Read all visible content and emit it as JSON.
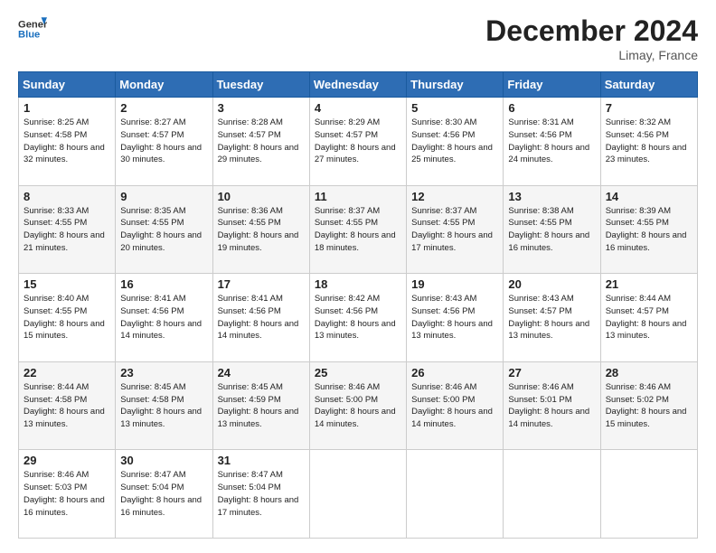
{
  "header": {
    "logo_general": "General",
    "logo_blue": "Blue",
    "month_title": "December 2024",
    "location": "Limay, France"
  },
  "days_of_week": [
    "Sunday",
    "Monday",
    "Tuesday",
    "Wednesday",
    "Thursday",
    "Friday",
    "Saturday"
  ],
  "weeks": [
    [
      {
        "day": "1",
        "sunrise": "Sunrise: 8:25 AM",
        "sunset": "Sunset: 4:58 PM",
        "daylight": "Daylight: 8 hours and 32 minutes."
      },
      {
        "day": "2",
        "sunrise": "Sunrise: 8:27 AM",
        "sunset": "Sunset: 4:57 PM",
        "daylight": "Daylight: 8 hours and 30 minutes."
      },
      {
        "day": "3",
        "sunrise": "Sunrise: 8:28 AM",
        "sunset": "Sunset: 4:57 PM",
        "daylight": "Daylight: 8 hours and 29 minutes."
      },
      {
        "day": "4",
        "sunrise": "Sunrise: 8:29 AM",
        "sunset": "Sunset: 4:57 PM",
        "daylight": "Daylight: 8 hours and 27 minutes."
      },
      {
        "day": "5",
        "sunrise": "Sunrise: 8:30 AM",
        "sunset": "Sunset: 4:56 PM",
        "daylight": "Daylight: 8 hours and 25 minutes."
      },
      {
        "day": "6",
        "sunrise": "Sunrise: 8:31 AM",
        "sunset": "Sunset: 4:56 PM",
        "daylight": "Daylight: 8 hours and 24 minutes."
      },
      {
        "day": "7",
        "sunrise": "Sunrise: 8:32 AM",
        "sunset": "Sunset: 4:56 PM",
        "daylight": "Daylight: 8 hours and 23 minutes."
      }
    ],
    [
      {
        "day": "8",
        "sunrise": "Sunrise: 8:33 AM",
        "sunset": "Sunset: 4:55 PM",
        "daylight": "Daylight: 8 hours and 21 minutes."
      },
      {
        "day": "9",
        "sunrise": "Sunrise: 8:35 AM",
        "sunset": "Sunset: 4:55 PM",
        "daylight": "Daylight: 8 hours and 20 minutes."
      },
      {
        "day": "10",
        "sunrise": "Sunrise: 8:36 AM",
        "sunset": "Sunset: 4:55 PM",
        "daylight": "Daylight: 8 hours and 19 minutes."
      },
      {
        "day": "11",
        "sunrise": "Sunrise: 8:37 AM",
        "sunset": "Sunset: 4:55 PM",
        "daylight": "Daylight: 8 hours and 18 minutes."
      },
      {
        "day": "12",
        "sunrise": "Sunrise: 8:37 AM",
        "sunset": "Sunset: 4:55 PM",
        "daylight": "Daylight: 8 hours and 17 minutes."
      },
      {
        "day": "13",
        "sunrise": "Sunrise: 8:38 AM",
        "sunset": "Sunset: 4:55 PM",
        "daylight": "Daylight: 8 hours and 16 minutes."
      },
      {
        "day": "14",
        "sunrise": "Sunrise: 8:39 AM",
        "sunset": "Sunset: 4:55 PM",
        "daylight": "Daylight: 8 hours and 16 minutes."
      }
    ],
    [
      {
        "day": "15",
        "sunrise": "Sunrise: 8:40 AM",
        "sunset": "Sunset: 4:55 PM",
        "daylight": "Daylight: 8 hours and 15 minutes."
      },
      {
        "day": "16",
        "sunrise": "Sunrise: 8:41 AM",
        "sunset": "Sunset: 4:56 PM",
        "daylight": "Daylight: 8 hours and 14 minutes."
      },
      {
        "day": "17",
        "sunrise": "Sunrise: 8:41 AM",
        "sunset": "Sunset: 4:56 PM",
        "daylight": "Daylight: 8 hours and 14 minutes."
      },
      {
        "day": "18",
        "sunrise": "Sunrise: 8:42 AM",
        "sunset": "Sunset: 4:56 PM",
        "daylight": "Daylight: 8 hours and 13 minutes."
      },
      {
        "day": "19",
        "sunrise": "Sunrise: 8:43 AM",
        "sunset": "Sunset: 4:56 PM",
        "daylight": "Daylight: 8 hours and 13 minutes."
      },
      {
        "day": "20",
        "sunrise": "Sunrise: 8:43 AM",
        "sunset": "Sunset: 4:57 PM",
        "daylight": "Daylight: 8 hours and 13 minutes."
      },
      {
        "day": "21",
        "sunrise": "Sunrise: 8:44 AM",
        "sunset": "Sunset: 4:57 PM",
        "daylight": "Daylight: 8 hours and 13 minutes."
      }
    ],
    [
      {
        "day": "22",
        "sunrise": "Sunrise: 8:44 AM",
        "sunset": "Sunset: 4:58 PM",
        "daylight": "Daylight: 8 hours and 13 minutes."
      },
      {
        "day": "23",
        "sunrise": "Sunrise: 8:45 AM",
        "sunset": "Sunset: 4:58 PM",
        "daylight": "Daylight: 8 hours and 13 minutes."
      },
      {
        "day": "24",
        "sunrise": "Sunrise: 8:45 AM",
        "sunset": "Sunset: 4:59 PM",
        "daylight": "Daylight: 8 hours and 13 minutes."
      },
      {
        "day": "25",
        "sunrise": "Sunrise: 8:46 AM",
        "sunset": "Sunset: 5:00 PM",
        "daylight": "Daylight: 8 hours and 14 minutes."
      },
      {
        "day": "26",
        "sunrise": "Sunrise: 8:46 AM",
        "sunset": "Sunset: 5:00 PM",
        "daylight": "Daylight: 8 hours and 14 minutes."
      },
      {
        "day": "27",
        "sunrise": "Sunrise: 8:46 AM",
        "sunset": "Sunset: 5:01 PM",
        "daylight": "Daylight: 8 hours and 14 minutes."
      },
      {
        "day": "28",
        "sunrise": "Sunrise: 8:46 AM",
        "sunset": "Sunset: 5:02 PM",
        "daylight": "Daylight: 8 hours and 15 minutes."
      }
    ],
    [
      {
        "day": "29",
        "sunrise": "Sunrise: 8:46 AM",
        "sunset": "Sunset: 5:03 PM",
        "daylight": "Daylight: 8 hours and 16 minutes."
      },
      {
        "day": "30",
        "sunrise": "Sunrise: 8:47 AM",
        "sunset": "Sunset: 5:04 PM",
        "daylight": "Daylight: 8 hours and 16 minutes."
      },
      {
        "day": "31",
        "sunrise": "Sunrise: 8:47 AM",
        "sunset": "Sunset: 5:04 PM",
        "daylight": "Daylight: 8 hours and 17 minutes."
      },
      null,
      null,
      null,
      null
    ]
  ]
}
